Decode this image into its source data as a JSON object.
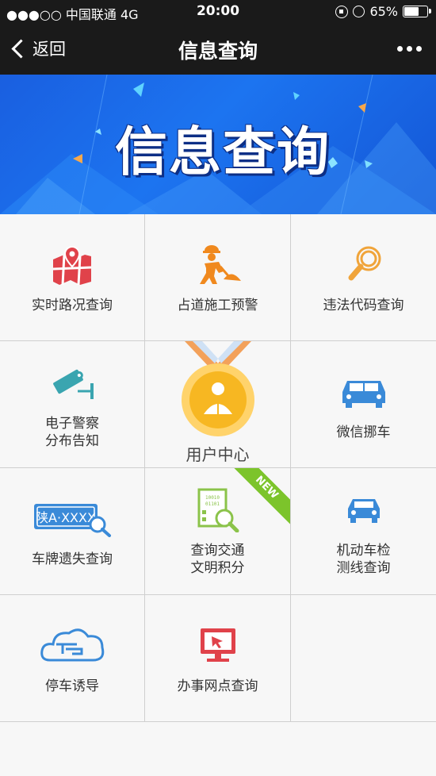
{
  "status_bar": {
    "carrier": "●●●○○ 中国联通  4G",
    "time": "20:00",
    "battery": "65%",
    "battery_level": 0.65
  },
  "nav": {
    "back_label": "返回",
    "title": "信息查询"
  },
  "banner": {
    "title": "信息查询"
  },
  "grid": {
    "items": [
      {
        "label": "实时路况查询",
        "icon": "map-pin-icon"
      },
      {
        "label": "占道施工预警",
        "icon": "construction-worker-icon"
      },
      {
        "label": "违法代码查询",
        "icon": "magnifier-icon"
      },
      {
        "label_line1": "电子警察",
        "label_line2": "分布告知",
        "icon": "surveillance-camera-icon"
      },
      {
        "label": "用户中心",
        "icon": "user-medal-icon"
      },
      {
        "label": "微信挪车",
        "icon": "cars-icon"
      },
      {
        "label": "车牌遗失查询",
        "icon": "license-plate-icon",
        "plate_text": "陕A·XXXX"
      },
      {
        "label_line1": "查询交通",
        "label_line2": "文明积分",
        "icon": "document-search-icon",
        "badge": "NEW"
      },
      {
        "label_line1": "机动车检",
        "label_line2": "测线查询",
        "icon": "car-icon"
      },
      {
        "label": "停车诱导",
        "icon": "parking-cloud-icon"
      },
      {
        "label": "办事网点查询",
        "icon": "monitor-cursor-icon"
      }
    ]
  },
  "colors": {
    "bar_bg": "#1a1a1a",
    "banner_blue": "#1c6ee8",
    "red_icon": "#e0424a",
    "orange_icon": "#f0891e",
    "teal_icon": "#3aa5b0",
    "blue_icon": "#3a8ad8",
    "green_badge": "#7cc42b",
    "gold_medal": "#f7b722"
  }
}
